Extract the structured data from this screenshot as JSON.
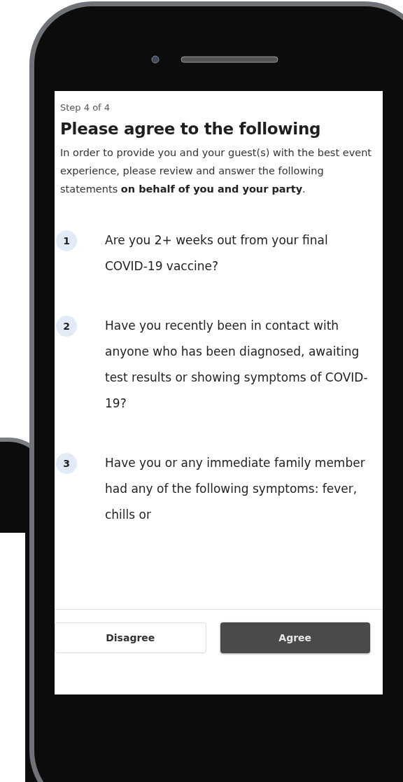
{
  "step": "Step 4 of 4",
  "title": "Please agree to the following",
  "intro": "In order to provide you and your guest(s) with the best event experience, please review and answer the following statements **on behalf of you and your party**.",
  "questions": [
    {
      "number": "1",
      "text": "Are you 2+ weeks out from your final COVID-19 vaccine?"
    },
    {
      "number": "2",
      "text": "Have you recently been in contact with anyone who has been diagnosed, awaiting test results or showing symptoms of COVID-19?"
    },
    {
      "number": "3",
      "text": "Have you or any immediate family member had any of the following symptoms: fever, chills or"
    }
  ],
  "buttons": [
    {
      "label": "Disagree",
      "kind": "secondary"
    },
    {
      "label": "Agree",
      "kind": "primary"
    }
  ]
}
